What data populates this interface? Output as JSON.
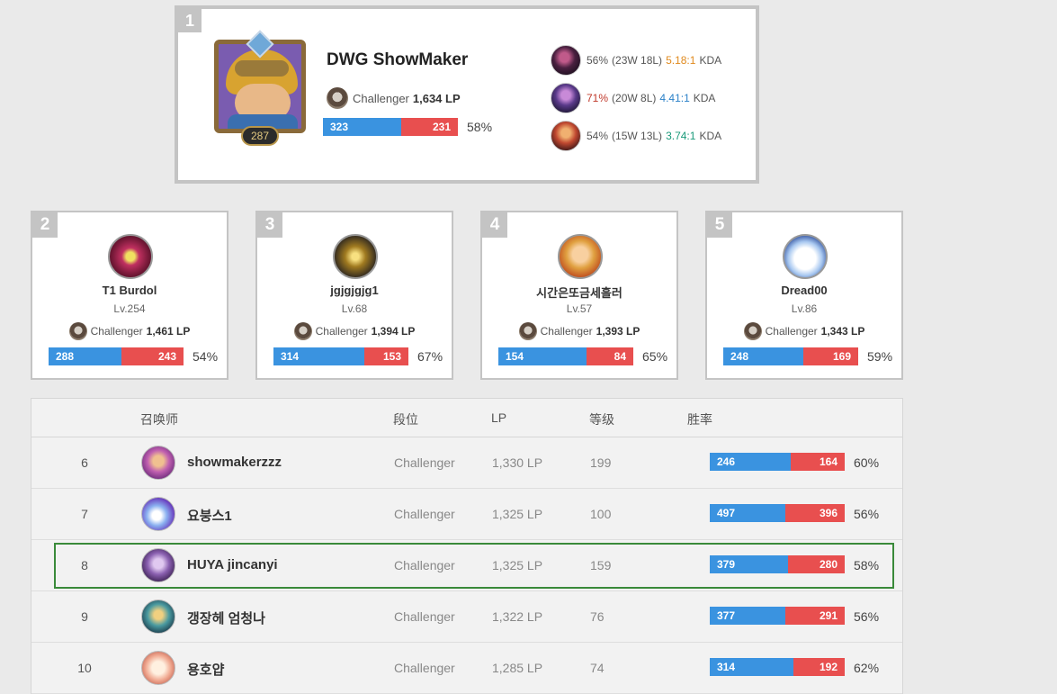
{
  "top": {
    "rank": "1",
    "name": "DWG ShowMaker",
    "level": "287",
    "tier": "Challenger",
    "lp": "1,634 LP",
    "wins": "323",
    "losses": "231",
    "win_ratio": 0.58,
    "winrate": "58%",
    "champions": [
      {
        "icon": "champion-1-icon",
        "winrate": "56%",
        "record": "(23W 18L)",
        "kda": "5.18:1",
        "kda_color": "#e08a1e",
        "kda_label": "KDA"
      },
      {
        "icon": "champion-2-icon",
        "winrate": "71%",
        "record": "(20W 8L)",
        "kda": "4.41:1",
        "kda_color": "#2a80c8",
        "kda_label": "KDA",
        "winrate_color": "#c0392b"
      },
      {
        "icon": "champion-3-icon",
        "winrate": "54%",
        "record": "(15W 13L)",
        "kda": "3.74:1",
        "kda_color": "#1a9a7a",
        "kda_label": "KDA"
      }
    ]
  },
  "runners_up": [
    {
      "rank": "2",
      "name": "T1 Burdol",
      "level": "Lv.254",
      "tier": "Challenger",
      "lp": "1,461 LP",
      "wins": "288",
      "losses": "243",
      "win_ratio": 0.54,
      "winrate": "54%"
    },
    {
      "rank": "3",
      "name": "jgjgjgjg1",
      "level": "Lv.68",
      "tier": "Challenger",
      "lp": "1,394 LP",
      "wins": "314",
      "losses": "153",
      "win_ratio": 0.67,
      "winrate": "67%"
    },
    {
      "rank": "4",
      "name": "시간은또금세흘러",
      "level": "Lv.57",
      "tier": "Challenger",
      "lp": "1,393 LP",
      "wins": "154",
      "losses": "84",
      "win_ratio": 0.65,
      "winrate": "65%"
    },
    {
      "rank": "5",
      "name": "Dread00",
      "level": "Lv.86",
      "tier": "Challenger",
      "lp": "1,343 LP",
      "wins": "248",
      "losses": "169",
      "win_ratio": 0.59,
      "winrate": "59%"
    }
  ],
  "table": {
    "headers": {
      "summoner": "召唤师",
      "tier": "段位",
      "lp": "LP",
      "level": "等级",
      "winrate": "胜率"
    },
    "rows": [
      {
        "rank": "6",
        "name": "showmakerzzz",
        "tier": "Challenger",
        "lp": "1,330 LP",
        "level": "199",
        "wins": "246",
        "losses": "164",
        "win_ratio": 0.6,
        "winrate": "60%"
      },
      {
        "rank": "7",
        "name": "요붕스1",
        "tier": "Challenger",
        "lp": "1,325 LP",
        "level": "100",
        "wins": "497",
        "losses": "396",
        "win_ratio": 0.56,
        "winrate": "56%"
      },
      {
        "rank": "8",
        "name": "HUYA jincanyi",
        "tier": "Challenger",
        "lp": "1,325 LP",
        "level": "159",
        "wins": "379",
        "losses": "280",
        "win_ratio": 0.58,
        "winrate": "58%"
      },
      {
        "rank": "9",
        "name": "갱장헤 엄청나",
        "tier": "Challenger",
        "lp": "1,322 LP",
        "level": "76",
        "wins": "377",
        "losses": "291",
        "win_ratio": 0.56,
        "winrate": "56%"
      },
      {
        "rank": "10",
        "name": "용호얍",
        "tier": "Challenger",
        "lp": "1,285 LP",
        "level": "74",
        "wins": "314",
        "losses": "192",
        "win_ratio": 0.62,
        "winrate": "62%"
      }
    ],
    "highlighted_rank": "8"
  },
  "colors": {
    "win": "#3a93e0",
    "loss": "#e84f4f",
    "highlight": "#3a8a3a"
  }
}
